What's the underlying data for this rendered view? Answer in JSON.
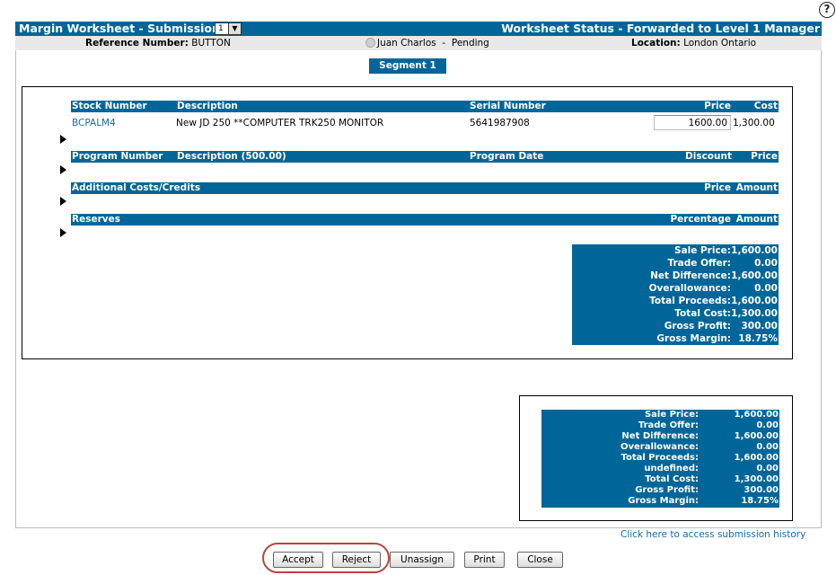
{
  "header": {
    "title": "Margin Worksheet - Submission",
    "selector_value": "1",
    "status": "Worksheet Status - Forwarded to Level 1 Manager"
  },
  "info": {
    "reference_label": "Reference Number:",
    "reference_value": "BUTTON",
    "user": "Juan Charlos  -  Pending",
    "location_label": "Location:",
    "location_value": "London Ontario"
  },
  "segment": {
    "tab_label": "Segment 1",
    "stock_headers": {
      "stock_number": "Stock Number",
      "description": "Description",
      "serial_number": "Serial Number",
      "price": "Price",
      "cost": "Cost"
    },
    "stock_row": {
      "stock_number": "BCPALM4",
      "description": "New JD 250 **COMPUTER TRK250 MONITOR",
      "serial_number": "5641987908",
      "price": "1600.00",
      "cost": "1,300.00"
    },
    "program_headers": {
      "program_number": "Program Number",
      "description": "Description (500.00)",
      "program_date": "Program Date",
      "discount": "Discount",
      "price": "Price"
    },
    "additional_headers": {
      "title": "Additional Costs/Credits",
      "price": "Price",
      "amount": "Amount"
    },
    "reserves_headers": {
      "title": "Reserves",
      "percentage": "Percentage",
      "amount": "Amount"
    },
    "summary": [
      {
        "label": "Sale Price:",
        "value": "1,600.00"
      },
      {
        "label": "Trade Offer:",
        "value": "0.00"
      },
      {
        "label": "Net Difference:",
        "value": "1,600.00"
      },
      {
        "label": "Overallowance:",
        "value": "0.00"
      },
      {
        "label": "Total Proceeds:",
        "value": "1,600.00"
      },
      {
        "label": "Total Cost:",
        "value": "1,300.00"
      },
      {
        "label": "Gross Profit:",
        "value": "300.00"
      },
      {
        "label": "Gross Margin:",
        "value": "18.75%"
      }
    ]
  },
  "totals": [
    {
      "label": "Sale Price:",
      "value": "1,600.00"
    },
    {
      "label": "Trade Offer:",
      "value": "0.00"
    },
    {
      "label": "Net Difference:",
      "value": "1,600.00"
    },
    {
      "label": "Overallowance:",
      "value": "0.00"
    },
    {
      "label": "Total Proceeds:",
      "value": "1,600.00"
    },
    {
      "label": "undefined:",
      "value": "0.00"
    },
    {
      "label": "Total Cost:",
      "value": "1,300.00"
    },
    {
      "label": "Gross Profit:",
      "value": "300.00"
    },
    {
      "label": "Gross Margin:",
      "value": "18.75%"
    }
  ],
  "history_link": "Click here to access submission history",
  "buttons": {
    "accept": "Accept",
    "reject": "Reject",
    "unassign": "Unassign",
    "print": "Print",
    "close": "Close"
  },
  "colors": {
    "header_blue": "#006699",
    "link_blue": "#1a6aa8",
    "highlight_red": "#b8443a"
  }
}
